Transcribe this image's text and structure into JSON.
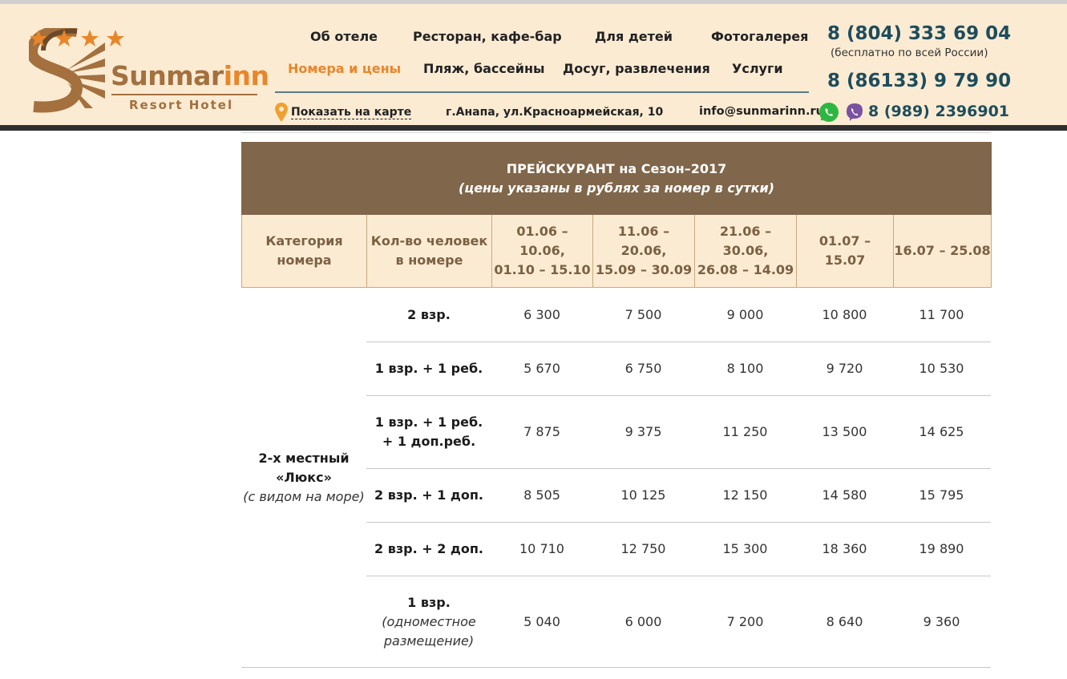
{
  "logo": {
    "name_main": "Sunmar",
    "name_accent": "inn",
    "subtitle": "Resort Hotel",
    "brand_color": "#a3703e",
    "accent_color": "#e9862a"
  },
  "nav": {
    "items": [
      {
        "label": "Об отеле",
        "active": false
      },
      {
        "label": "Ресторан, кафе-бар",
        "active": false
      },
      {
        "label": "Для детей",
        "active": false
      },
      {
        "label": "Фотогалерея",
        "active": false
      },
      {
        "label": "Номера и цены",
        "active": true
      },
      {
        "label": "Пляж, бассейны",
        "active": false
      },
      {
        "label": "Досуг, развлечения",
        "active": false
      },
      {
        "label": "Услуги",
        "active": false
      }
    ]
  },
  "contacts": {
    "phone_main": "8 (804) 333 69 04",
    "phone_main_note": "(бесплатно по всей России)",
    "phone_local": "8 (86133) 9 79 90",
    "map_link": "Показать на карте",
    "address": "г.Анапа, ул.Красноармейская, 10",
    "email": "info@sunmarinn.ru",
    "mobile": "8 (989) 2396901",
    "icons": [
      "map-pin-icon",
      "whatsapp-icon",
      "viber-icon"
    ]
  },
  "price_table": {
    "title": "ПРЕЙСКУРАНТ на Сезон–2017",
    "subtitle": "(цены указаны в рублях за номер в сутки)",
    "header_color": "#80664a",
    "columns": [
      {
        "l1": "Категория",
        "l2": "номера"
      },
      {
        "l1": "Кол-во человек",
        "l2": "в номере"
      },
      {
        "l1": "01.06 – 10.06,",
        "l2": "01.10 – 15.10"
      },
      {
        "l1": "11.06 – 20.06,",
        "l2": "15.09 – 30.09"
      },
      {
        "l1": "21.06 – 30.06,",
        "l2": "26.08 – 14.09"
      },
      {
        "l1": "01.07 – 15.07",
        "l2": ""
      },
      {
        "l1": "16.07 – 25.08",
        "l2": ""
      }
    ],
    "category": {
      "line1": "2-х местный",
      "line2": "«Люкс»",
      "line3": "(с видом на море)"
    },
    "rows": [
      {
        "g1": "2 взр.",
        "g2": "",
        "g3": "",
        "p": [
          "6 300",
          "7 500",
          "9 000",
          "10 800",
          "11 700"
        ]
      },
      {
        "g1": "1 взр. + 1 реб.",
        "g2": "",
        "g3": "",
        "p": [
          "5 670",
          "6 750",
          "8 100",
          "9 720",
          "10 530"
        ]
      },
      {
        "g1": "1 взр. + 1 реб.",
        "g2": "+ 1 доп.реб.",
        "g3": "",
        "p": [
          "7 875",
          "9 375",
          "11 250",
          "13 500",
          "14 625"
        ]
      },
      {
        "g1": "2 взр. + 1 доп.",
        "g2": "",
        "g3": "",
        "p": [
          "8 505",
          "10 125",
          "12 150",
          "14 580",
          "15 795"
        ]
      },
      {
        "g1": "2 взр. + 2 доп.",
        "g2": "",
        "g3": "",
        "p": [
          "10 710",
          "12 750",
          "15 300",
          "18 360",
          "19 890"
        ]
      },
      {
        "g1": "1 взр.",
        "g2": "",
        "g3": "(одноместное размещение)",
        "p": [
          "5 040",
          "6 000",
          "7 200",
          "8 640",
          "9 360"
        ]
      }
    ]
  }
}
